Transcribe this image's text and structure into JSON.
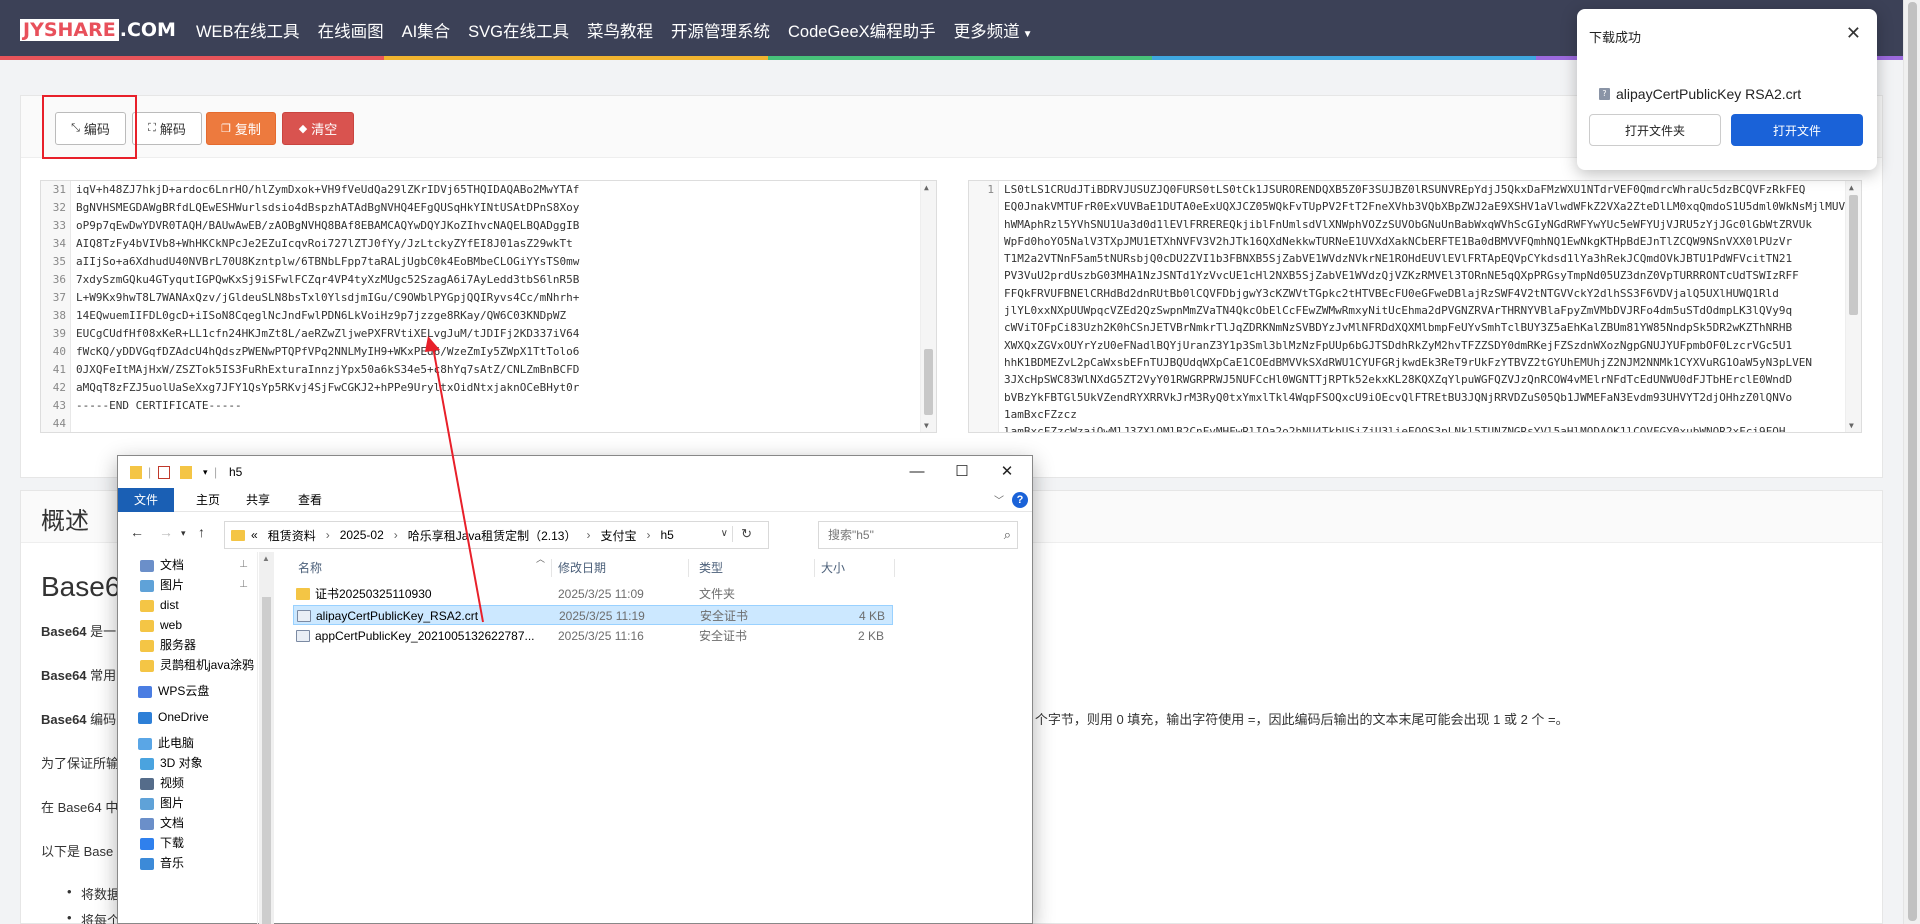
{
  "nav": {
    "logo_box": "JYSHARE",
    "logo_text": ".COM",
    "links": [
      "WEB在线工具",
      "在线画图",
      "AI集合",
      "SVG在线工具",
      "菜鸟教程",
      "开源管理系统",
      "CodeGeeX编程助手",
      "更多频道"
    ]
  },
  "toolbar": {
    "encode_label": "编码",
    "decode_label": "解码",
    "copy_label": "复制",
    "clear_label": "清空"
  },
  "input_editor": {
    "line_numbers": [
      "31",
      "32",
      "33",
      "34",
      "35",
      "36",
      "37",
      "38",
      "39",
      "40",
      "41",
      "42",
      "43",
      "44"
    ],
    "lines": [
      "iqV+h48ZJ7hkjD+ardoc6LnrHO/hlZymDxok+VH9fVeUdQa29lZKrIDVj65THQIDAQABo2MwYTAf",
      "BgNVHSMEGDAWgBRfdLQEwESHWurlsdsio4dBspzhATAdBgNVHQ4EFgQUSqHkYINtUSAtDPnS8Xoy",
      "oP9p7qEwDwYDVR0TAQH/BAUwAwEB/zAOBgNVHQ8BAf8EBAMCAQYwDQYJKoZIhvcNAQELBQADggIB",
      "AIQ8TzFy4bVIVb8+WhHKCkNPcJe2EZuIcqvRoi727lZTJ0fYy/JzLtckyZYfEI8J01asZ29wkTt",
      "aIIjSo+a6XdhudU40NVBrL70U8Kzntplw/6TBNbLFpp7taRALjUgbC0k4EoBMbeCLOGiYYsTS0mw",
      "7xdySzmGQku4GTyqutIGPQwKxSj9iSFwlFCZqr4VP4tyXzMUgc52SzagA6i7AyLedd3tbS6lnR5B",
      "L+W9Kx9hwT8L7WANAxQzv/jGldeuSLN8bsTxl0YlsdjmIGu/C9OWblPYGpjQQIRyvs4Cc/mNhrh+",
      "14EQwuemIIFDL0gcD+iISoN8CqeglNcJndFwlPDN6LkVoiHz9p7jzzge8RKay/QW6C03KNDpWZ",
      "EUCgCUdfHf08xKeR+LL1cfn24HKJmZt8L/aeRZwZljwePXFRVtiXELvgJuM/tJDIFj2KD337iV64",
      "fWcKQ/yDDVGqfDZAdcU4hQdszPWENwPTQPfVPq2NNLMyIH9+WKxPEd6/WzeZmIy5ZWpX1TtTolo6",
      "0JXQFeItMAjHxW/ZSZTok5IS3FuRhExturaInnzjYpx50a6kS34e5+c8hYq7sAtZ/CNLZmBnBCFD",
      "aMQqT8zFZJ5uolUaSeXxg7JFY1QsYp5RKvj4SjFwCGKJ2+hPPe9UryltxOidNtxjaknOCeBHyt0r",
      "-----END CERTIFICATE-----",
      ""
    ]
  },
  "output_editor": {
    "line_numbers": [
      "1"
    ],
    "lines": [
      "LS0tLS1CRUdJTiBDRVJUSUZJQ0FURS0tLS0tCk1JSURORENDQXB5Z0F3SUJBZ0lRSUNVREpYdjJ5QkxDaFMzWXU1NTdrVEF0QmdrcWhraUc5dzBCQVFzRkFEQ",
      "EQ0JnakVMTUFrR0ExVUVBaE1DUTA0eExUQXJCZ05WQkFvTUpPV2FtT2FneXVhb3VQbXBpZWJ2aE9XSHV1aVlwdWFkZ2VXa2ZteDlLM0xqQmdoS1U5dml0WkNsMjlMUVFN",
      "hWMAphRzl5YVhSNU1Ua3d0d1lEVlFRREREQkjiblFnUmlsdVlXNWphVOZzSUVObGNuUnBabWxqWVhScGIyNGdRWFYwYUc5eWFYUjVJRU5zYjJGc0lGbWtZRVUk",
      "WpFd0hoYO5NalV3TXpJMU1ETXhNVFV3V2hJTk16QXdNekkwTURNeE1UVXdXakNCbERFTE1Ba0dBMVVFQmhNQ1EwNkgKTHpBdEJnTlZCQW9NSnVXX0lPUzVr",
      "T1M2a2VTNnF5am5tNURsbjQ0cDU2ZVI1b3FBNXB5SjZabVE1WVdzNVkrNE1ROHdEUVlEVlFRTApEQVpCYkdsd1lYa3hRekJCQmdOVkJBTU1PdWFVcitTN21",
      "PV3VuU2prdUszbG03MHA1NzJSNTd1YzVvcUE1cHl2NXB5SjZabVE1WVdzQjVZKzRMVEl3TORnNE5qQXpPRGsyTmpNd05UZ3dnZ0VpTURRRONTcUdTSWIzRFF",
      "FFQkFRVUFBNElCRHdBd2dnRUtBb0lCQVFDbjgwY3cKZWVtTGpkc2tHTVBEcFU0eGFweDBlajRzSWF4V2tNTGVVckY2dlhSS3F6VDVjalQ5UXlHUWQ1Rld",
      "jlYL0xxNXpUUWpqcVZEd2QzSwpnMmZVaTN4QkcObElCcFEwZWMwRmxyNitUcEhma2dPVGNZRVArTHRNYVBlaFpyZmVMbDVJRFo4dm5uSTdOdmpLK3lQVy9q",
      "cWViTOFpCi83Uzh2K0hCSnJETVBrNmkrTlJqZDRKNmNzSVBDYzJvMlNFRDdXQXMlbmpFeUYvSmhTclBUY3Z5aEhKalZBUm81YW85NndpSk5DR2wKZThNRHB",
      "XWXQxZGVxOUYrYzU0eFNadlBQYjUranZ3Y1p3Sml3blMzNzFpUUp6bGJTSDdhRkZyM2hvTFZZSDY0dmRKejFZSzdnWXozNgpGNUJYUFpmbOF0LzcrVGc5U1",
      "hhK1BDMEZvL2pCaWxsbEFnTUJBQUdqWXpCaE1COEdBMVVkSXdRWU1CYUFGRjkwdEk3ReT9rUkFzYTBVZ2tGYUhEMUhjZ2NJM2NNMk1CYXVuRG1OaW5yN3pLVEN",
      "3JXcHpSWC83WlNXdG5ZT2VyY01RWGRPRWJ5NUFCcHl0WGNTTjRPTk52ekxKL28KQXZqYlpuWGFQZVJzQnRCOW4vMElrNFdTcEdUNWU0dFJTbHErclE0WndD",
      "bVBzYkFBTGl5UkVZendRYXRRVkJrM3RyQ0txYmxlTkl4WqpFSOQxcU9iOEcvQlFTREtBU3JQNjRRVDZuS05Qb1JWMEFaN3Evdm93UHVYT2djOHhzZ0lQNVo",
      "1amBxcFZzcz",
      "lamBxcFZzcWzajQwMlJ3ZXlQMlB2CnFvMHFwRlIQa2o2bNU4TkbUSiZjU3lieEQOS3pLNkl5TUNZNGRsYVl5aHlMODAOK1lCQVFGY0xubWNOR2xFci9FQH"
    ]
  },
  "article": {
    "section_title": "概述",
    "heading": "Base6",
    "paragraphs": [
      {
        "bold": "Base64",
        "rest": " 是一"
      },
      {
        "bold": "Base64",
        "rest": " 常用"
      },
      {
        "bold": "Base64",
        "rest": " 编码"
      },
      {
        "bold": "",
        "rest": "为了保证所输"
      },
      {
        "bold": "",
        "rest": "在 Base64 中"
      },
      {
        "bold": "",
        "rest": "以下是 Base"
      }
    ],
    "para3_tail": "3 个字节，则用 0 填充，输出字符使用 =，因此编码后输出的文本末尾可能会出现 1 或 2 个 =。",
    "bullets": [
      "将数据",
      "将每个"
    ]
  },
  "download_popup": {
    "title": "下载成功",
    "filename": "alipayCertPublicKey RSA2.crt",
    "open_folder_label": "打开文件夹",
    "open_file_label": "打开文件"
  },
  "explorer": {
    "window_title": "h5",
    "ribbon_tabs": [
      "文件",
      "主页",
      "共享",
      "查看"
    ],
    "breadcrumb": [
      "«",
      "租赁资料",
      "2025-02",
      "哈乐享租Java租赁定制（2.13）",
      "支付宝",
      "h5"
    ],
    "search_placeholder": "搜索\"h5\"",
    "sidebar": [
      {
        "name": "文档",
        "icon": "documents-icon",
        "color": "#6b8fc9",
        "pin": true
      },
      {
        "name": "图片",
        "icon": "pictures-icon",
        "color": "#5fa2d8",
        "pin": true
      },
      {
        "name": "dist",
        "icon": "folder-icon",
        "color": "#f4c545",
        "pin": false
      },
      {
        "name": "web",
        "icon": "folder-icon",
        "color": "#f4c545",
        "pin": false
      },
      {
        "name": "服务器",
        "icon": "folder-icon",
        "color": "#f4c545",
        "pin": false
      },
      {
        "name": "灵鹊租机java涂鸦",
        "icon": "folder-icon",
        "color": "#f4c545",
        "pin": false
      },
      {
        "name": "WPS云盘",
        "icon": "cloud-icon",
        "color": "#4a7de2",
        "pin": false
      },
      {
        "name": "OneDrive",
        "icon": "onedrive-icon",
        "color": "#2d7fd7",
        "pin": false
      },
      {
        "name": "此电脑",
        "icon": "computer-icon",
        "color": "#5aa6e6",
        "pin": false
      },
      {
        "name": "3D 对象",
        "icon": "3d-objects-icon",
        "color": "#4aa3df",
        "pin": false
      },
      {
        "name": "视频",
        "icon": "videos-icon",
        "color": "#556c8a",
        "pin": false
      },
      {
        "name": "图片",
        "icon": "pictures-icon",
        "color": "#5fa2d8",
        "pin": false
      },
      {
        "name": "文档",
        "icon": "documents-icon",
        "color": "#6b8fc9",
        "pin": false
      },
      {
        "name": "下载",
        "icon": "downloads-icon",
        "color": "#2f80ed",
        "pin": false
      },
      {
        "name": "音乐",
        "icon": "music-icon",
        "color": "#3c8ad8",
        "pin": false
      }
    ],
    "columns": [
      "名称",
      "修改日期",
      "类型",
      "大小"
    ],
    "files": [
      {
        "name": "证书20250325110930",
        "date": "2025/3/25 11:09",
        "type": "文件夹",
        "size": "",
        "icon": "folder-icon",
        "selected": false
      },
      {
        "name": "alipayCertPublicKey_RSA2.crt",
        "date": "2025/3/25 11:19",
        "type": "安全证书",
        "size": "4 KB",
        "icon": "certificate-icon",
        "selected": true
      },
      {
        "name": "appCertPublicKey_2021005132622787...",
        "date": "2025/3/25 11:16",
        "type": "安全证书",
        "size": "2 KB",
        "icon": "certificate-icon",
        "selected": false
      }
    ]
  },
  "colors": {
    "nav_bg": "#3c4157",
    "accent_red": "#e8202a",
    "primary_blue": "#1a62d8",
    "selection": "#cce8ff"
  }
}
